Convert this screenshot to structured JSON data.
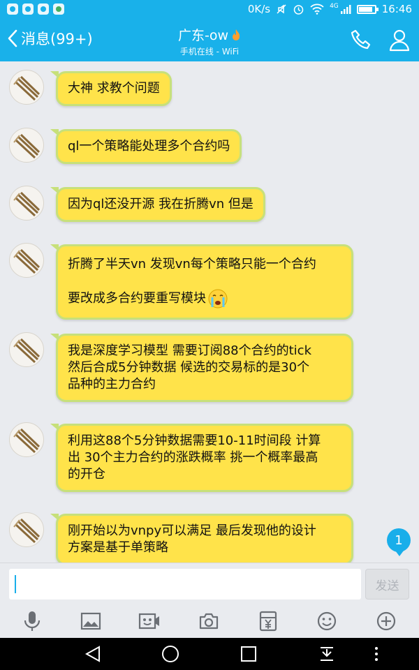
{
  "status_bar": {
    "network_speed": "0K/s",
    "network_type": "4G",
    "time": "16:46",
    "battery_level": 0.85,
    "icons": [
      "app-icon-1",
      "app-icon-2",
      "app-icon-3",
      "wechat-icon",
      "mute-icon",
      "alarm-icon",
      "wifi-icon",
      "signal-icon",
      "battery-icon"
    ]
  },
  "header": {
    "back_label": "消息(99+)",
    "contact_name": "广东-ow",
    "presence": "手机在线 - WiFi",
    "icons": [
      "back-chevron-icon",
      "flame-icon",
      "phone-icon",
      "person-icon"
    ]
  },
  "messages": [
    {
      "lines": [
        "大神 求教个问题"
      ]
    },
    {
      "lines": [
        "ql一个策略能处理多个合约吗"
      ]
    },
    {
      "lines": [
        "因为ql还没开源 我在折腾vn 但是"
      ]
    },
    {
      "lines": [
        "折腾了半天vn 发现vn每个策略只能一个合约",
        "要改成多合约要重写模块"
      ],
      "emoji": "crying-face-emoji"
    },
    {
      "lines": [
        "我是深度学习模型 需要订阅88个合约的tick",
        "然后合成5分钟数据 候选的交易标的是30个",
        "品种的主力合约"
      ]
    },
    {
      "lines": [
        "利用这88个5分钟数据需要10-11时间段 计算",
        "出 30个主力合约的涨跌概率 挑一个概率最高",
        "的开仓"
      ]
    },
    {
      "lines": [
        "刚开始以为vnpy可以满足 最后发现他的设计",
        "方案是基于单策略"
      ]
    }
  ],
  "unread_badge": "1",
  "composer": {
    "input_value": "",
    "send_label": "发送"
  },
  "toolbar_icons": [
    "microphone-icon",
    "image-icon",
    "video-icon",
    "camera-icon",
    "red-packet-icon",
    "emoji-icon",
    "plus-icon"
  ],
  "nav_icons": [
    "nav-back-icon",
    "nav-home-icon",
    "nav-recents-icon",
    "nav-notification-icon",
    "nav-menu-icon"
  ],
  "colors": {
    "accent": "#19b1ea",
    "bubble_fill": "#ffe34a",
    "bubble_border": "#c7e07a",
    "chat_background": "#e9ebef"
  }
}
